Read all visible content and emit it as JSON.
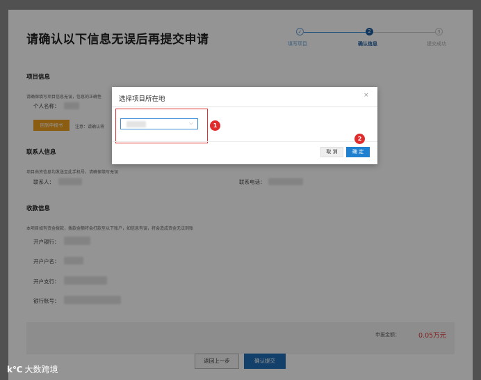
{
  "header": {
    "title": "请确认以下信息无误后再提交申请",
    "steps": [
      {
        "label": "填写项目",
        "number": "✓",
        "state": "done"
      },
      {
        "label": "确认信息",
        "number": "2",
        "state": "active"
      },
      {
        "label": "提交成功",
        "number": "3",
        "state": "pending"
      }
    ]
  },
  "project": {
    "section_title": "项目信息",
    "hint": "请确保填写项目信息无误，信息的正确性",
    "name_label": "个人名称：",
    "button_label": "回到申报书",
    "note": "注意：请确认将"
  },
  "contact": {
    "section_title": "联系人信息",
    "hint": "项目由资信息均发送至此手机号，请确保填写无误",
    "contact_label": "联系人：",
    "phone_label": "联系电话："
  },
  "payment": {
    "section_title": "收款信息",
    "hint": "本项目如有资金拨款，拨款金额将会打款至以下账户，如信息有误，将会造成资金无法到账",
    "bank_label": "开户银行：",
    "account_name_label": "开户户名：",
    "branch_label": "开户支行：",
    "account_no_label": "银行账号："
  },
  "summary": {
    "amount_label": "申报金额：",
    "amount_value": "0.05万元"
  },
  "footer": {
    "back_label": "返回上一步",
    "submit_label": "确认提交"
  },
  "dialog": {
    "title": "选择项目所在地",
    "close_label": "×",
    "select_chevron": "⌵",
    "cancel_label": "取 消",
    "confirm_label": "确 定",
    "badge_1": "1",
    "badge_2": "2"
  },
  "watermark": {
    "logo": "k℃",
    "text": "大数跨境"
  },
  "colors": {
    "accent": "#1f80d0",
    "highlight": "#e02c2c",
    "orange": "#f0a020",
    "amount": "#e23a3a"
  }
}
